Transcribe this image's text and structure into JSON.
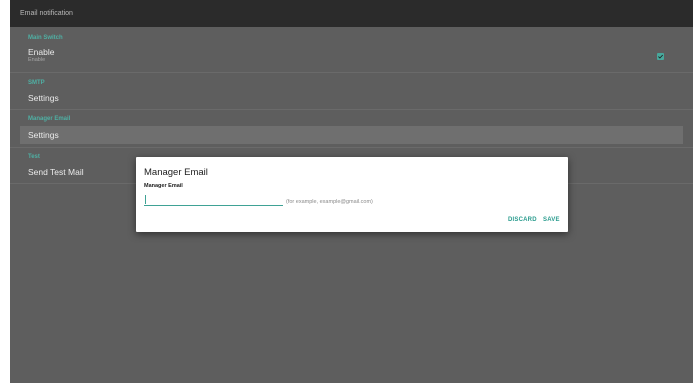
{
  "appbar": {
    "title": "Email notification"
  },
  "sections": {
    "main_switch": {
      "header": "Main Switch",
      "enable_title": "Enable",
      "enable_summary": "Enable",
      "enabled": true
    },
    "smtp": {
      "header": "SMTP",
      "settings_label": "Settings"
    },
    "manager_email": {
      "header": "Manager Email",
      "settings_label": "Settings"
    },
    "test": {
      "header": "Test",
      "send_label": "Send Test Mail"
    }
  },
  "dialog": {
    "title": "Manager Email",
    "field_label": "Manager Email",
    "input_value": "",
    "hint": "(for example, example@gmail.com)",
    "discard_label": "DISCARD",
    "save_label": "SAVE"
  },
  "colors": {
    "accent": "#4fb0a4",
    "background": "#5e5e5e",
    "appbar": "#2b2b2b",
    "dialog": "#ffffff"
  },
  "icons": {
    "checkbox": "checkbox-checked-icon"
  }
}
